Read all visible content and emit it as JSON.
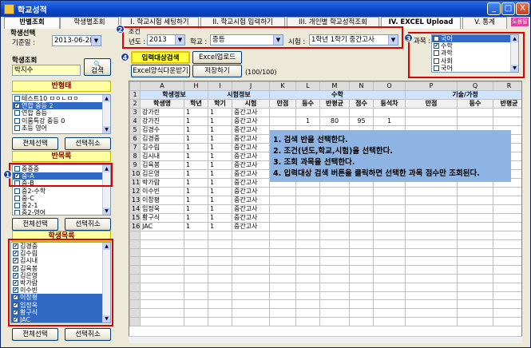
{
  "window": {
    "title": "학교성적",
    "min": "_",
    "max": "□",
    "close": "X"
  },
  "tabs": [
    "반별조회",
    "학생별조회",
    "I. 학교시험 세팅하기",
    "II. 학교시험 입력하기",
    "III. 개인별 학교성적조회",
    "IV. EXCEL Upload",
    "V. 통계"
  ],
  "help_badge": "도움말",
  "left": {
    "student_select_label": "학생선택",
    "base_date_label": "기준일 :",
    "base_date": "2013-06-28",
    "student_search_label": "학생조회",
    "search_value": "박지수",
    "search_button": "검색",
    "class_list_title": "반형태",
    "class_list": [
      {
        "label": "테스트10 ㅁㅇㄴㅁㅇ",
        "checked": false,
        "selected": false
      },
      {
        "label": "연합 중등 2",
        "checked": true,
        "selected": true
      },
      {
        "label": "연합 중등",
        "checked": false,
        "selected": false
      },
      {
        "label": "이룸특강 중등 0",
        "checked": false,
        "selected": false
      },
      {
        "label": "초등 영어",
        "checked": false,
        "selected": false
      }
    ],
    "select_all_1": "전체선택",
    "deselect_1": "선택취소",
    "class_group_title": "반목록",
    "class_group_list": [
      {
        "label": "중중중",
        "checked": false,
        "selected": false
      },
      {
        "label": "중-A",
        "checked": true,
        "selected": true
      },
      {
        "label": "중-B",
        "checked": false,
        "selected": false
      },
      {
        "label": "중2-수학",
        "checked": false,
        "selected": false
      },
      {
        "label": "중-C",
        "checked": false,
        "selected": false
      },
      {
        "label": "중2-1",
        "checked": false,
        "selected": false
      },
      {
        "label": "중2-영어",
        "checked": false,
        "selected": false
      }
    ],
    "select_all_2": "전체선택",
    "deselect_2": "선택취소",
    "student_list_title": "학생목록",
    "student_list": [
      {
        "label": "김경중",
        "checked": true,
        "selected": false
      },
      {
        "label": "김수림",
        "checked": true,
        "selected": false
      },
      {
        "label": "김시내",
        "checked": true,
        "selected": false
      },
      {
        "label": "김육봉",
        "checked": true,
        "selected": false
      },
      {
        "label": "김은영",
        "checked": true,
        "selected": false
      },
      {
        "label": "박가람",
        "checked": true,
        "selected": false
      },
      {
        "label": "이수빈",
        "checked": true,
        "selected": false
      },
      {
        "label": "이창평",
        "checked": true,
        "selected": true
      },
      {
        "label": "임정욱",
        "checked": true,
        "selected": true
      },
      {
        "label": "황구식",
        "checked": true,
        "selected": true
      },
      {
        "label": "JAC",
        "checked": true,
        "selected": true
      }
    ],
    "select_all_3": "전체선택",
    "deselect_3": "선택취소"
  },
  "conditions": {
    "group_label": "조건",
    "year_label": "년도 :",
    "year": "2013",
    "school_label": "학교 :",
    "school": "중등",
    "exam_label": "시험 :",
    "exam": "1학년 1학기 중간고사"
  },
  "subjects": {
    "label": "과목 :",
    "items": [
      {
        "label": "국어",
        "checked": false,
        "selected": true
      },
      {
        "label": "수학",
        "checked": true,
        "selected": false
      },
      {
        "label": "과학",
        "checked": false,
        "selected": false
      },
      {
        "label": "사회",
        "checked": false,
        "selected": false
      },
      {
        "label": "국어",
        "checked": false,
        "selected": false
      }
    ]
  },
  "actions": {
    "search_target": "입력대상검색",
    "excel_upload": "Excel업로드",
    "excel_form": "Excel양식다운받기",
    "save": "저장하기",
    "count": "(100/100)"
  },
  "badges": [
    "1",
    "2",
    "3",
    "4"
  ],
  "grid": {
    "col_letters": [
      "",
      "A",
      "H",
      "I",
      "J",
      "K",
      "L",
      "M",
      "N",
      "O",
      "P",
      "Q",
      "R"
    ],
    "row1": {
      "student_info": "학생정보",
      "exam_info": "시험정보",
      "math": "수학",
      "tech": "기술/가정"
    },
    "row2": [
      "학생명",
      "학년",
      "학기",
      "시험",
      "만점",
      "등수",
      "반평균",
      "점수",
      "등석차",
      "만점",
      "등수",
      "반평균"
    ],
    "rows": [
      {
        "n": "3",
        "name": "강가린",
        "grade": "1",
        "term": "1",
        "exam": "중간고사",
        "m_avg": "",
        "m_score": "",
        "m_rank": ""
      },
      {
        "n": "4",
        "name": "강가진",
        "grade": "1",
        "term": "1",
        "exam": "중간고사",
        "m_rank2": "1",
        "m_avg": "80",
        "m_score": "95",
        "m_rank": "1"
      },
      {
        "n": "5",
        "name": "김경수",
        "grade": "1",
        "term": "1",
        "exam": "중간고사"
      },
      {
        "n": "6",
        "name": "김경중",
        "grade": "1",
        "term": "1",
        "exam": "중간고사"
      },
      {
        "n": "7",
        "name": "김수림",
        "grade": "1",
        "term": "1",
        "exam": "중간고사"
      },
      {
        "n": "8",
        "name": "김시내",
        "grade": "1",
        "term": "1",
        "exam": "중간고사"
      },
      {
        "n": "9",
        "name": "김육봉",
        "grade": "1",
        "term": "1",
        "exam": "중간고사"
      },
      {
        "n": "10",
        "name": "김은영",
        "grade": "1",
        "term": "1",
        "exam": "중간고사"
      },
      {
        "n": "11",
        "name": "박가람",
        "grade": "1",
        "term": "1",
        "exam": "중간고사"
      },
      {
        "n": "12",
        "name": "이수빈",
        "grade": "1",
        "term": "1",
        "exam": "중간고사"
      },
      {
        "n": "13",
        "name": "이창평",
        "grade": "1",
        "term": "1",
        "exam": "중간고사"
      },
      {
        "n": "14",
        "name": "임정욱",
        "grade": "1",
        "term": "1",
        "exam": "중간고사"
      },
      {
        "n": "15",
        "name": "황구식",
        "grade": "1",
        "term": "1",
        "exam": "중간고사"
      },
      {
        "n": "16",
        "name": "JAC",
        "grade": "1",
        "term": "1",
        "exam": "중간고사"
      }
    ],
    "instructions": [
      "1. 검색 반을 선택한다.",
      "2. 조건(년도,학교,시험)을 선택한다.",
      "3. 조회 과목을 선택한다.",
      "4. 입력대상 검색 버튼을 클릭하면 선택한 과목 점수만 조회된다."
    ]
  },
  "colors": {
    "highlight": "#316ac5",
    "note": "#8db4e2",
    "annotation_red": "#e00000",
    "yellow_title": "#ffffa0"
  }
}
